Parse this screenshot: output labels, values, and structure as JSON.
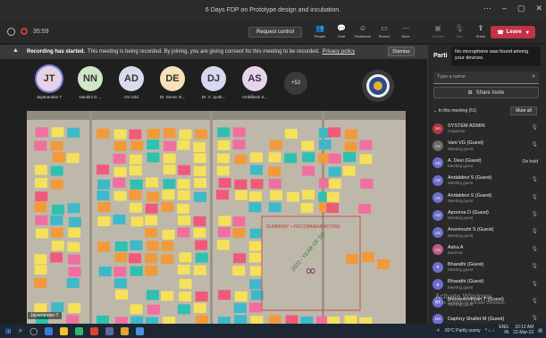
{
  "window": {
    "title": "6 Days FDP on Prototype design and incubation."
  },
  "toolbar": {
    "timer": "35:59",
    "request_control": "Request control",
    "buttons": [
      {
        "label": "People",
        "glyph": "👥",
        "state": "active"
      },
      {
        "label": "Chat",
        "glyph": "💬",
        "state": "normal"
      },
      {
        "label": "Reactions",
        "glyph": "☺",
        "state": "normal"
      },
      {
        "label": "Rooms",
        "glyph": "▭",
        "state": "normal"
      },
      {
        "label": "More",
        "glyph": "⋯",
        "state": "normal"
      },
      {
        "label": "Camera",
        "glyph": "▣",
        "state": "dim"
      },
      {
        "label": "Mic",
        "glyph": "🎙",
        "state": "dim"
      },
      {
        "label": "Share",
        "glyph": "⇪",
        "state": "active"
      }
    ],
    "leave": "Leave"
  },
  "banner": {
    "bold": "Recording has started.",
    "text": "This meeting is being recorded. By joining, you are giving consent for this meeting to be recorded.",
    "link": "Privacy policy",
    "dismiss": "Dismiss"
  },
  "gallery": {
    "tiles": [
      {
        "initials": "JT",
        "label": "Jayanandan T",
        "color": "#e8d2e4"
      },
      {
        "initials": "NN",
        "label": "Nandini G ...",
        "color": "#cfe6c9"
      },
      {
        "initials": "AD",
        "label": "On hold",
        "color": "#d6dcee"
      },
      {
        "initials": "DE",
        "label": "Dr. Suma- E...",
        "color": "#f6e2b5"
      },
      {
        "initials": "DJ",
        "label": "Dr. V. Jyoth...",
        "color": "#d7d8f0"
      },
      {
        "initials": "AS",
        "label": "Ambilikesi S...",
        "color": "#e6d4ec"
      }
    ],
    "more": "+52"
  },
  "stage": {
    "presenter": "Jayanandan T",
    "board_text": {
      "summary": "SUMMARY + RECOMMENDATIONS",
      "year": "2022 - YEAR OF SO"
    }
  },
  "panel": {
    "title": "Parti",
    "tooltip": "No microphone was found among your devices.",
    "search_placeholder": "Type a name",
    "share_invite": "Share invite",
    "in_meeting": "In this meeting (61)",
    "mute_all": "Mute all",
    "participants": [
      {
        "initials": "SA",
        "name": "SYSTEM ADMIN",
        "role": "Organizer",
        "color": "#b0383f",
        "status": ""
      },
      {
        "initials": "VV",
        "name": "Vani VG (Guest)",
        "role": "Meeting guest",
        "color": "#6b6b6b",
        "status": ""
      },
      {
        "initials": "AD",
        "name": "A. Devi (Guest)",
        "role": "Meeting guest",
        "color": "#6e6ecf",
        "status": "On hold"
      },
      {
        "initials": "AS",
        "name": "Andaldevi S (Guest)",
        "role": "Meeting guest",
        "color": "#6e6ecf",
        "status": ""
      },
      {
        "initials": "AS",
        "name": "Andaldevi S (Guest)",
        "role": "Meeting guest",
        "color": "#6e6ecf",
        "status": ""
      },
      {
        "initials": "AD",
        "name": "Apoorva D (Guest)",
        "role": "Meeting guest",
        "color": "#6e6ecf",
        "status": ""
      },
      {
        "initials": "AS",
        "name": "Arunmozhi S (Guest)",
        "role": "Meeting guest",
        "color": "#6e6ecf",
        "status": ""
      },
      {
        "initials": "AA",
        "name": "Asha A",
        "role": "External",
        "color": "#c05a8a",
        "status": ""
      },
      {
        "initials": "B",
        "name": "Bharathi (Guest)",
        "role": "Meeting guest",
        "color": "#6e6ecf",
        "status": ""
      },
      {
        "initials": "B",
        "name": "Bharathi (Guest)",
        "role": "Meeting guest",
        "color": "#6e6ecf",
        "status": ""
      },
      {
        "initials": "BT",
        "name": "bhuvanendhran.T (Guest)",
        "role": "Meeting guest",
        "color": "#6e6ecf",
        "status": ""
      },
      {
        "initials": "DS",
        "name": "Daphny Shallet M (Guest)",
        "role": "",
        "color": "#6e6ecf",
        "status": ""
      }
    ],
    "activate_title": "Activate Windows",
    "activate_sub": "Go to Settings to activate Windows."
  },
  "taskbar": {
    "weather": "26°C Partly sunny",
    "lang_top": "ENG",
    "lang_bottom": "IN",
    "time": "10:12 AM",
    "date": "22-Mar-22",
    "apps": [
      "#3a7bd5",
      "#f2c12e",
      "#2bb673",
      "#d9432f",
      "#6264a7",
      "#e8a23a",
      "#4a90e2"
    ]
  },
  "icons": {
    "record": "record-icon",
    "warning": "warning-icon",
    "search": "search-icon",
    "mic_off": "mic-off-icon",
    "phone": "phone-hangup-icon"
  }
}
